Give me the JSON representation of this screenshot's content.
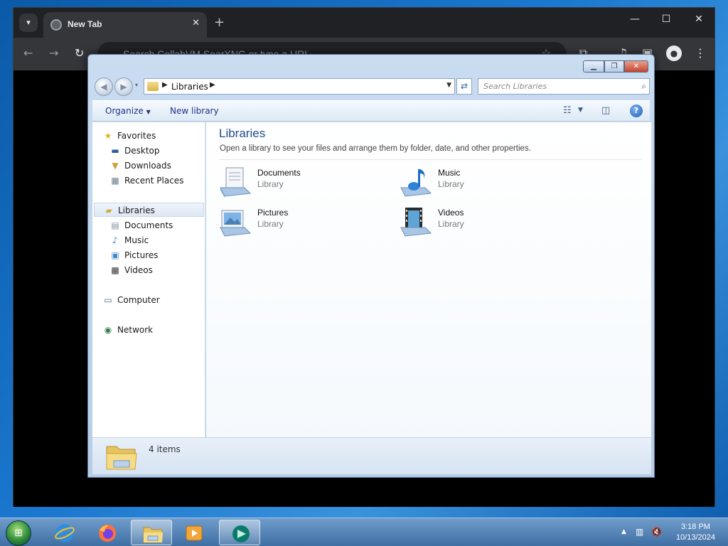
{
  "browser": {
    "tab_title": "New Tab",
    "omnibox_placeholder": "Search CollabVM SearXNG or type a URL"
  },
  "explorer": {
    "address": {
      "crumb": "Libraries"
    },
    "search": {
      "placeholder": "Search Libraries"
    },
    "toolbar": {
      "organize_label": "Organize",
      "new_library_label": "New library"
    },
    "nav": {
      "favorites": {
        "label": "Favorites",
        "items": [
          {
            "label": "Desktop",
            "icon": "desktop-icon"
          },
          {
            "label": "Downloads",
            "icon": "downloads-icon"
          },
          {
            "label": "Recent Places",
            "icon": "recent-places-icon"
          }
        ]
      },
      "libraries": {
        "label": "Libraries",
        "items": [
          {
            "label": "Documents",
            "icon": "documents-icon"
          },
          {
            "label": "Music",
            "icon": "music-icon"
          },
          {
            "label": "Pictures",
            "icon": "pictures-icon"
          },
          {
            "label": "Videos",
            "icon": "videos-icon"
          }
        ]
      },
      "computer_label": "Computer",
      "network_label": "Network"
    },
    "content": {
      "title": "Libraries",
      "subtitle": "Open a library to see your files and arrange them by folder, date, and other properties.",
      "libraries": [
        {
          "name": "Documents",
          "type": "Library",
          "icon": "documents-library-icon"
        },
        {
          "name": "Music",
          "type": "Library",
          "icon": "music-library-icon"
        },
        {
          "name": "Pictures",
          "type": "Library",
          "icon": "pictures-library-icon"
        },
        {
          "name": "Videos",
          "type": "Library",
          "icon": "videos-library-icon"
        }
      ]
    },
    "details": {
      "item_count": "4 items"
    }
  },
  "taskbar": {
    "apps": [
      "internet-explorer-icon",
      "firefox-icon",
      "file-explorer-icon",
      "media-player-icon",
      "app-icon"
    ],
    "clock": {
      "time": "3:18 PM",
      "date": "10/13/2024"
    }
  },
  "colors": {
    "accent": "#1e4d8c",
    "link": "#1e3287",
    "desktop": "#1b78d0"
  }
}
